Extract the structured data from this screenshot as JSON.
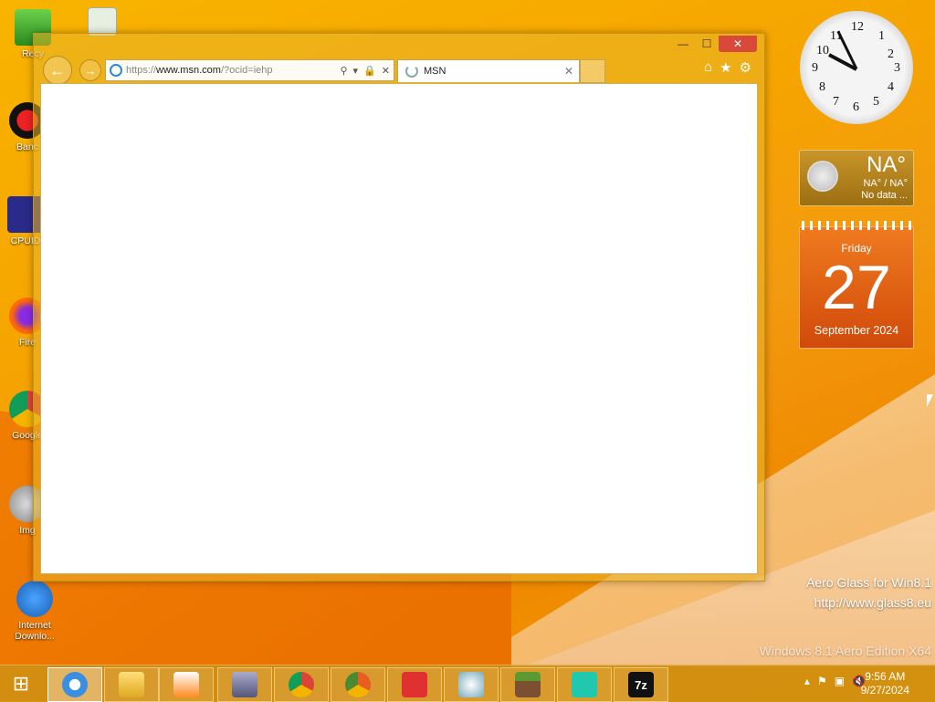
{
  "desktop": {
    "icons": [
      {
        "label": "Recy",
        "name": "recycle-bin"
      },
      {
        "label": "Banc",
        "name": "bandicam"
      },
      {
        "label": "CPUID",
        "name": "cpuid"
      },
      {
        "label": "Fire",
        "name": "firefox"
      },
      {
        "label": "Google",
        "name": "google-chrome"
      },
      {
        "label": "Img",
        "name": "img-app"
      },
      {
        "label": "Internet Downlo...",
        "name": "internet-download-manager"
      }
    ],
    "watermark_line1": "Aero Glass for Win8.1",
    "watermark_line2": "http://www.glass8.eu",
    "watermark_line3": "Windows 8.1 Aero Edition X64"
  },
  "browser": {
    "url_prefix": "https://",
    "url_host": "www.msn.com",
    "url_rest": "/?ocid=iehp",
    "tab_title": "MSN"
  },
  "gadgets": {
    "weather_temp": "NA°",
    "weather_range": "NA° / NA°",
    "weather_status": "No data ...",
    "cal_day": "Friday",
    "cal_date": "27",
    "cal_month": "September 2024"
  },
  "taskbar": {
    "time": "9:56 AM",
    "date": "9/27/2024",
    "items": [
      "internet-explorer",
      "file-explorer",
      "media-player",
      "archive-tool",
      "google-chrome",
      "chrome-alt",
      "roblox",
      "paint",
      "minecraft",
      "terminal-app",
      "7-zip"
    ],
    "sevenzip_label": "7z"
  },
  "colors": {
    "accent": "#f6a400",
    "close": "#d8493a"
  }
}
